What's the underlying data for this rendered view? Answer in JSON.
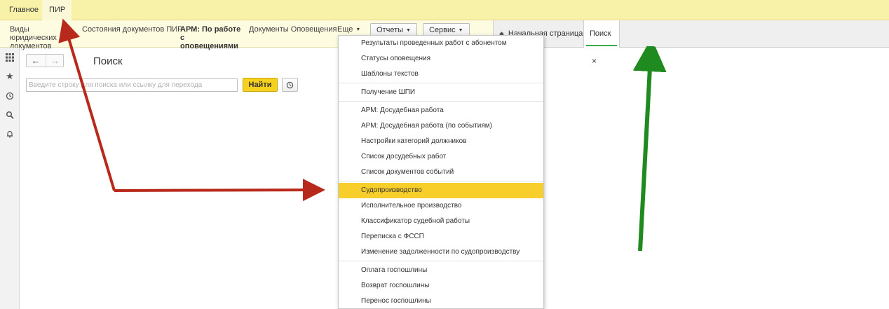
{
  "top_tabs": [
    {
      "label": "Главное"
    },
    {
      "label": "ПИР"
    }
  ],
  "section_bar": {
    "items": [
      {
        "label": "Виды юридических документов"
      },
      {
        "label": "Состояния документов ПИР"
      },
      {
        "label": "АРМ: По работе с оповещениями"
      },
      {
        "label": "Документы Оповещения"
      },
      {
        "label": "Еще"
      }
    ],
    "reports_label": "Отчеты",
    "service_label": "Сервис"
  },
  "window_tabs": [
    {
      "label": "Начальная страница"
    },
    {
      "label": "Поиск",
      "close": "×"
    }
  ],
  "page": {
    "title": "Поиск",
    "search_placeholder": "Введите строку для поиска или ссылку для перехода",
    "find_label": "Найти",
    "back": "←",
    "forward": "→"
  },
  "sidebar_icons": [
    "apps-grid-icon",
    "star-icon",
    "history-icon",
    "search-icon",
    "bell-icon"
  ],
  "dropdown": {
    "groups": [
      [
        "Результаты проведенных работ с абонентом",
        "Статусы оповещения",
        "Шаблоны текстов"
      ],
      [
        "Получение ШПИ"
      ],
      [
        "АРМ: Досудебная работа",
        "АРМ: Досудебная работа (по событиям)",
        "Настройки категорий должников",
        "Список досудебных работ",
        "Список документов событий"
      ],
      [
        "Судопроизводство",
        "Исполнительное производство",
        "Классификатор судебной работы",
        "Переписка с ФССП",
        "Изменение задолженности по судопроизводству"
      ],
      [
        "Оплата госпошлины",
        "Возврат госпошлины",
        "Перенос госпошлины"
      ]
    ],
    "selected": "Судопроизводство"
  },
  "colors": {
    "accent_yellow": "#f8cf2a",
    "red_arrow": "#b8291c",
    "green_arrow": "#1f8a1f",
    "active_tab_underline": "#3cab4b"
  }
}
